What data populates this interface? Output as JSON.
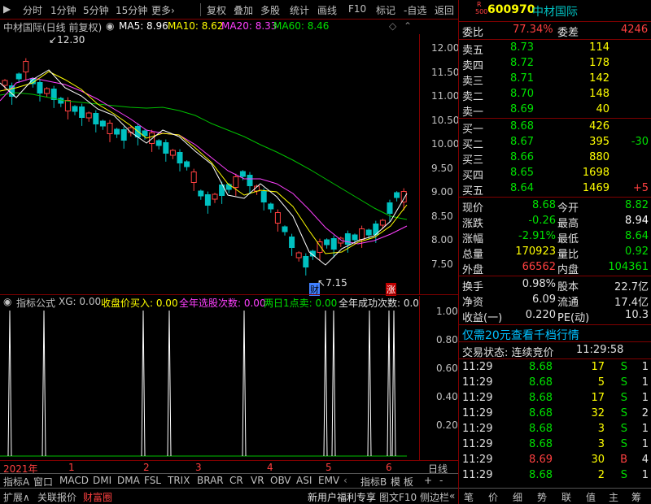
{
  "toolbar": {
    "items": [
      "分时",
      "1分钟",
      "5分钟",
      "15分钟",
      "更多›",
      "复权",
      "叠加",
      "多股",
      "统计",
      "画线",
      "F10",
      "标记",
      "-自选",
      "返回"
    ]
  },
  "kline_header": {
    "title": "中材国际(日线 前复权)",
    "ma5": "MA5: 8.96",
    "ma10": "MA10: 8.62",
    "ma20": "MA20: 8.33",
    "ma60": "MA60: 8.46"
  },
  "price_axis": [
    "12.00",
    "11.50",
    "11.00",
    "10.50",
    "10.00",
    "9.50",
    "9.00",
    "8.50",
    "8.00",
    "7.50"
  ],
  "annotations": {
    "high": "12.30",
    "low": "7.15",
    "cai": "财",
    "zhang": "涨"
  },
  "indicator_header": {
    "name": "指标公式",
    "xg": "XG: 0.00",
    "buy": "收盘价买入: 0.00",
    "year_count": "全年选股次数: 0.00",
    "two_day": "两日1点卖: 0.00",
    "year_success": "全年成功次数: 0.0"
  },
  "indicator_axis": [
    "1.00",
    "0.80",
    "0.60",
    "0.40",
    "0.20"
  ],
  "date_axis": {
    "year": "2021年",
    "months": [
      "1",
      "2",
      "3",
      "4",
      "5",
      "6"
    ],
    "right_label": "日线"
  },
  "indicator_tabs": [
    "指标A",
    "窗口",
    "MACD",
    "DMI",
    "DMA",
    "FSL",
    "TRIX",
    "BRAR",
    "CR",
    "VR",
    "OBV",
    "ASI",
    "EMV",
    "指标B",
    "模 板",
    "+",
    "-"
  ],
  "bottom_tabs": [
    "扩展∧",
    "关联报价",
    "财富圈"
  ],
  "bottom_right": "新用户福利专享",
  "bottom_btns": [
    "图文F10",
    "侧边栏"
  ],
  "stock": {
    "code": "600970",
    "name": "中材国际",
    "r_label": "R",
    "board": "500"
  },
  "order_book": {
    "weibi_label": "委比",
    "weibi": "77.34%",
    "weicha_label": "委差",
    "weicha": "4246",
    "asks": [
      {
        "label": "卖五",
        "price": "8.73",
        "vol": "114"
      },
      {
        "label": "卖四",
        "price": "8.72",
        "vol": "178"
      },
      {
        "label": "卖三",
        "price": "8.71",
        "vol": "142"
      },
      {
        "label": "卖二",
        "price": "8.70",
        "vol": "148"
      },
      {
        "label": "卖一",
        "price": "8.69",
        "vol": "40"
      }
    ],
    "bids": [
      {
        "label": "买一",
        "price": "8.68",
        "vol": "426",
        "chg": ""
      },
      {
        "label": "买二",
        "price": "8.67",
        "vol": "395",
        "chg": "-30"
      },
      {
        "label": "买三",
        "price": "8.66",
        "vol": "880",
        "chg": ""
      },
      {
        "label": "买四",
        "price": "8.65",
        "vol": "1698",
        "chg": ""
      },
      {
        "label": "买五",
        "price": "8.64",
        "vol": "1469",
        "chg": "+5"
      }
    ]
  },
  "quote": [
    {
      "l1": "现价",
      "v1": "8.68",
      "l2": "今开",
      "v2": "8.82"
    },
    {
      "l1": "涨跌",
      "v1": "-0.26",
      "l2": "最高",
      "v2": "8.94"
    },
    {
      "l1": "涨幅",
      "v1": "-2.91%",
      "l2": "最低",
      "v2": "8.64"
    },
    {
      "l1": "总量",
      "v1": "170923",
      "l2": "量比",
      "v2": "0.92"
    },
    {
      "l1": "外盘",
      "v1": "66562",
      "l2": "内盘",
      "v2": "104361"
    }
  ],
  "fundamentals": [
    {
      "l1": "换手",
      "v1": "0.98%",
      "l2": "股本",
      "v2": "22.7亿"
    },
    {
      "l1": "净资",
      "v1": "6.09",
      "l2": "流通",
      "v2": "17.4亿"
    },
    {
      "l1": "收益(一)",
      "v1": "0.220",
      "l2": "PE(动)",
      "v2": "10.3"
    }
  ],
  "promo": "仅需20元查看千档行情",
  "trade_status": {
    "label": "交易状态: 连续竞价",
    "time": "11:29:58"
  },
  "ticks": [
    {
      "time": "11:29",
      "price": "8.68",
      "vol": "17",
      "side": "S",
      "n": "1"
    },
    {
      "time": "11:29",
      "price": "8.68",
      "vol": "5",
      "side": "S",
      "n": "1"
    },
    {
      "time": "11:29",
      "price": "8.68",
      "vol": "17",
      "side": "S",
      "n": "1"
    },
    {
      "time": "11:29",
      "price": "8.68",
      "vol": "32",
      "side": "S",
      "n": "2"
    },
    {
      "time": "11:29",
      "price": "8.68",
      "vol": "3",
      "side": "S",
      "n": "1"
    },
    {
      "time": "11:29",
      "price": "8.68",
      "vol": "3",
      "side": "S",
      "n": "1"
    },
    {
      "time": "11:29",
      "price": "8.69",
      "vol": "30",
      "side": "B",
      "n": "4"
    },
    {
      "time": "11:29",
      "price": "8.68",
      "vol": "2",
      "side": "S",
      "n": "1"
    }
  ],
  "right_bottom_tabs": [
    "笔",
    "价",
    "细",
    "势",
    "联",
    "值",
    "主",
    "筹"
  ],
  "colors": {
    "up": "#ff4040",
    "down": "#00e000",
    "ma5": "#ffffff",
    "ma10": "#ffff00",
    "ma20": "#ff40ff",
    "ma60": "#00c000",
    "frame": "#800000"
  }
}
